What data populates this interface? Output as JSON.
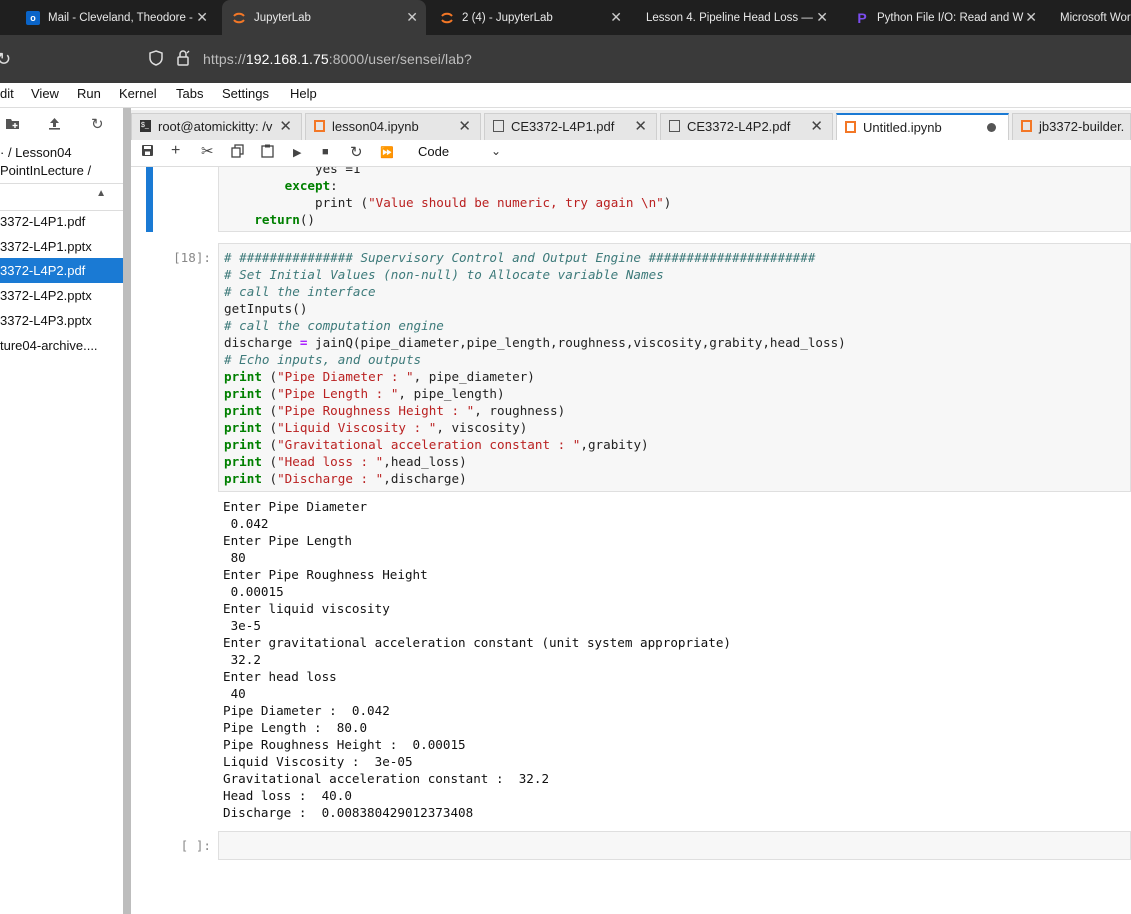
{
  "browser": {
    "tabs": [
      {
        "title": "Mail - Cleveland, Theodore -",
        "icon": "outlook-icon",
        "closable": true
      },
      {
        "title": "JupyterLab",
        "icon": "jupyter-icon",
        "closable": true,
        "active": true
      },
      {
        "title": "2 (4) - JupyterLab",
        "icon": "jupyter-icon",
        "closable": true
      },
      {
        "title": "Lesson 4. Pipeline Head Loss —",
        "icon": "",
        "closable": true
      },
      {
        "title": "Python File I/O: Read and W",
        "icon": "programiz-icon",
        "closable": true
      },
      {
        "title": "Microsoft Wor",
        "icon": "",
        "closable": false
      }
    ],
    "url_prefix": "https://",
    "url_host": "192.168.1.75",
    "url_rest": ":8000/user/sensei/lab?"
  },
  "menu": [
    "dit",
    "View",
    "Run",
    "Kernel",
    "Tabs",
    "Settings",
    "Help"
  ],
  "sidebar": {
    "breadcrumb_line1": "·  / Lesson04",
    "breadcrumb_line2": "PointInLecture /",
    "files": [
      {
        "name": "3372-L4P1.pdf"
      },
      {
        "name": "3372-L4P1.pptx"
      },
      {
        "name": "3372-L4P2.pdf",
        "selected": true
      },
      {
        "name": "3372-L4P2.pptx"
      },
      {
        "name": "3372-L4P3.pptx"
      },
      {
        "name": "ture04-archive...."
      }
    ]
  },
  "doc_tabs": [
    {
      "label": "root@atomickitty: /v",
      "icon": "terminal-icon"
    },
    {
      "label": "lesson04.ipynb",
      "icon": "notebook-icon"
    },
    {
      "label": "CE3372-L4P1.pdf",
      "icon": "file-icon"
    },
    {
      "label": "CE3372-L4P2.pdf",
      "icon": "file-icon"
    },
    {
      "label": "Untitled.ipynb",
      "icon": "notebook-icon",
      "active": true,
      "unsaved": true
    },
    {
      "label": "jb3372-builder.",
      "icon": "notebook-icon"
    }
  ],
  "notebook_toolbar": {
    "cell_type": "Code",
    "tools": [
      "save-icon",
      "add-icon",
      "cut-icon",
      "copy-icon",
      "paste-icon",
      "run-icon",
      "stop-icon",
      "restart-icon",
      "fast-forward-icon"
    ]
  },
  "cells": {
    "prev_tail": {
      "line1_a": "            yes =1",
      "line2_kw": "except",
      "line3_a": "            print (",
      "line3_s": "\"Value should be numeric, try again \\n\"",
      "line3_b": ")",
      "line4_kw": "return",
      "line4_b": "()"
    },
    "cell18": {
      "prompt": "[18]:",
      "lines": [
        {
          "t": "cm",
          "text": "# ############### Supervisory Control and Output Engine ######################"
        },
        {
          "t": "cm",
          "text": "# Set Initial Values (non-null) to Allocate variable Names"
        },
        {
          "t": "cm",
          "text": "# call the interface"
        },
        {
          "t": "plain",
          "text": "getInputs()"
        },
        {
          "t": "cm",
          "text": "# call the computation engine"
        },
        {
          "t": "assign",
          "a": "discharge ",
          "op": "=",
          "b": " jainQ(pipe_diameter,pipe_length,roughness,viscosity,grabity,head_loss)"
        },
        {
          "t": "cm",
          "text": "# Echo inputs, and outputs"
        },
        {
          "t": "print",
          "s": "\"Pipe Diameter : \"",
          "b": ", pipe_diameter)"
        },
        {
          "t": "print",
          "s": "\"Pipe Length : \"",
          "b": ", pipe_length)"
        },
        {
          "t": "print",
          "s": "\"Pipe Roughness Height : \"",
          "b": ", roughness)"
        },
        {
          "t": "print",
          "s": "\"Liquid Viscosity : \"",
          "b": ", viscosity)"
        },
        {
          "t": "print",
          "s": "\"Gravitational acceleration constant : \"",
          "b": ",grabity)"
        },
        {
          "t": "print",
          "s": "\"Head loss : \"",
          "b": ",head_loss)"
        },
        {
          "t": "print",
          "s": "\"Discharge : \"",
          "b": ",discharge)"
        }
      ],
      "print_kw": "print",
      "output": [
        "Enter Pipe Diameter",
        " 0.042",
        "Enter Pipe Length",
        " 80",
        "Enter Pipe Roughness Height",
        " 0.00015",
        "Enter liquid viscosity",
        " 3e-5",
        "Enter gravitational acceleration constant (unit system appropriate)",
        " 32.2",
        "Enter head loss",
        " 40",
        "Pipe Diameter :  0.042",
        "Pipe Length :  80.0",
        "Pipe Roughness Height :  0.00015",
        "Liquid Viscosity :  3e-05",
        "Gravitational acceleration constant :  32.2",
        "Head loss :  40.0",
        "Discharge :  0.008380429012373408"
      ]
    },
    "empty_prompt": "[ ]:"
  },
  "colors": {
    "accent": "#1a7ad4",
    "comment": "#3d7a7a",
    "string": "#ba2121",
    "keyword": "#008000"
  }
}
